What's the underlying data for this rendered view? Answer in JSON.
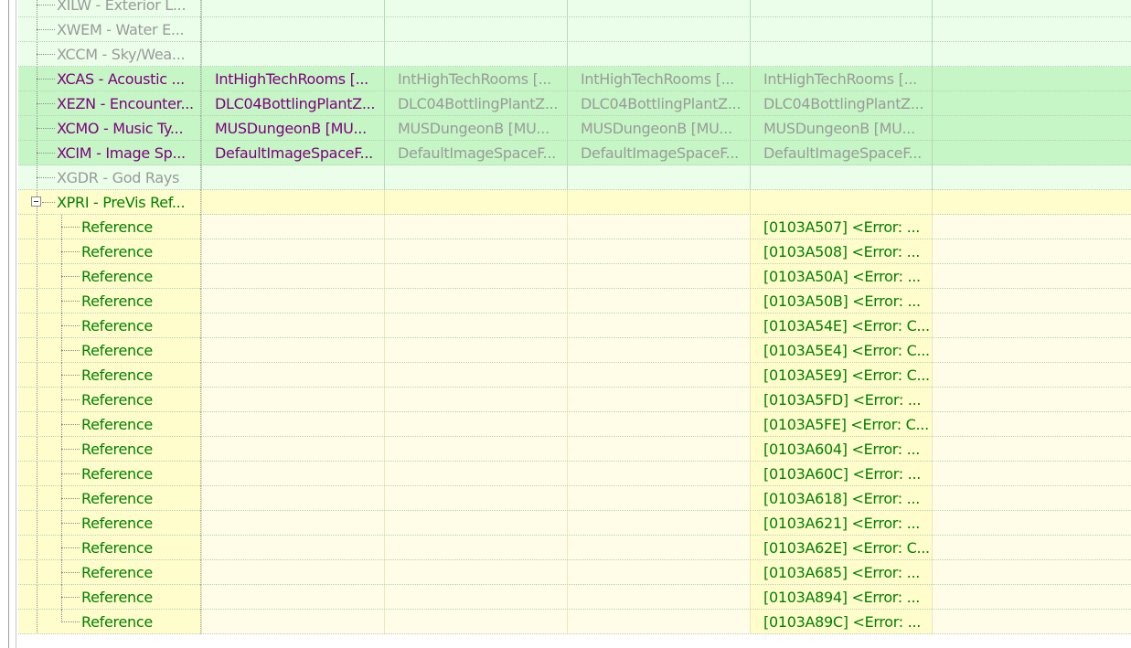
{
  "colors": {
    "row_green_light": "#eafeea",
    "row_green_mid": "#c6f6c6",
    "row_yellow": "#fffdcc",
    "row_yellow_light": "#fffde8",
    "text_gray": "#9a9a9a",
    "text_purple": "#800080",
    "text_green": "#008000"
  },
  "record_rows": [
    {
      "label": "XILW - Exterior L...",
      "state": "inactive",
      "values": [
        "",
        "",
        "",
        ""
      ]
    },
    {
      "label": "XWEM - Water E...",
      "state": "inactive",
      "values": [
        "",
        "",
        "",
        ""
      ]
    },
    {
      "label": "XCCM - Sky/Wea...",
      "state": "inactive",
      "values": [
        "",
        "",
        "",
        ""
      ]
    },
    {
      "label": "XCAS - Acoustic ...",
      "state": "conflict",
      "values": [
        "IntHighTechRooms [...",
        "IntHighTechRooms [...",
        "IntHighTechRooms [...",
        "IntHighTechRooms [..."
      ]
    },
    {
      "label": "XEZN - Encounter...",
      "state": "conflict",
      "values": [
        "DLC04BottlingPlantZ...",
        "DLC04BottlingPlantZ...",
        "DLC04BottlingPlantZ...",
        "DLC04BottlingPlantZ..."
      ]
    },
    {
      "label": "XCMO - Music Ty...",
      "state": "conflict",
      "values": [
        "MUSDungeonB [MU...",
        "MUSDungeonB [MU...",
        "MUSDungeonB [MU...",
        "MUSDungeonB [MU..."
      ]
    },
    {
      "label": "XCIM - Image Sp...",
      "state": "conflict",
      "values": [
        "DefaultImageSpaceF...",
        "DefaultImageSpaceF...",
        "DefaultImageSpaceF...",
        "DefaultImageSpaceF..."
      ]
    },
    {
      "label": "XGDR - God Rays",
      "state": "inactive",
      "values": [
        "",
        "",
        "",
        ""
      ]
    }
  ],
  "previs_group": {
    "label": "XPRI - PreVis Ref...",
    "expanded": true,
    "reference_label": "Reference",
    "references": [
      "[0103A507] <Error: ...",
      "[0103A508] <Error: ...",
      "[0103A50A] <Error: ...",
      "[0103A50B] <Error: ...",
      "[0103A54E] <Error: C...",
      "[0103A5E4] <Error: C...",
      "[0103A5E9] <Error: C...",
      "[0103A5FD] <Error: ...",
      "[0103A5FE] <Error: C...",
      "[0103A604] <Error: ...",
      "[0103A60C] <Error: ...",
      "[0103A618] <Error: ...",
      "[0103A621] <Error: ...",
      "[0103A62E] <Error: C...",
      "[0103A685] <Error: ...",
      "[0103A894] <Error: ...",
      "[0103A89C] <Error: ..."
    ]
  }
}
